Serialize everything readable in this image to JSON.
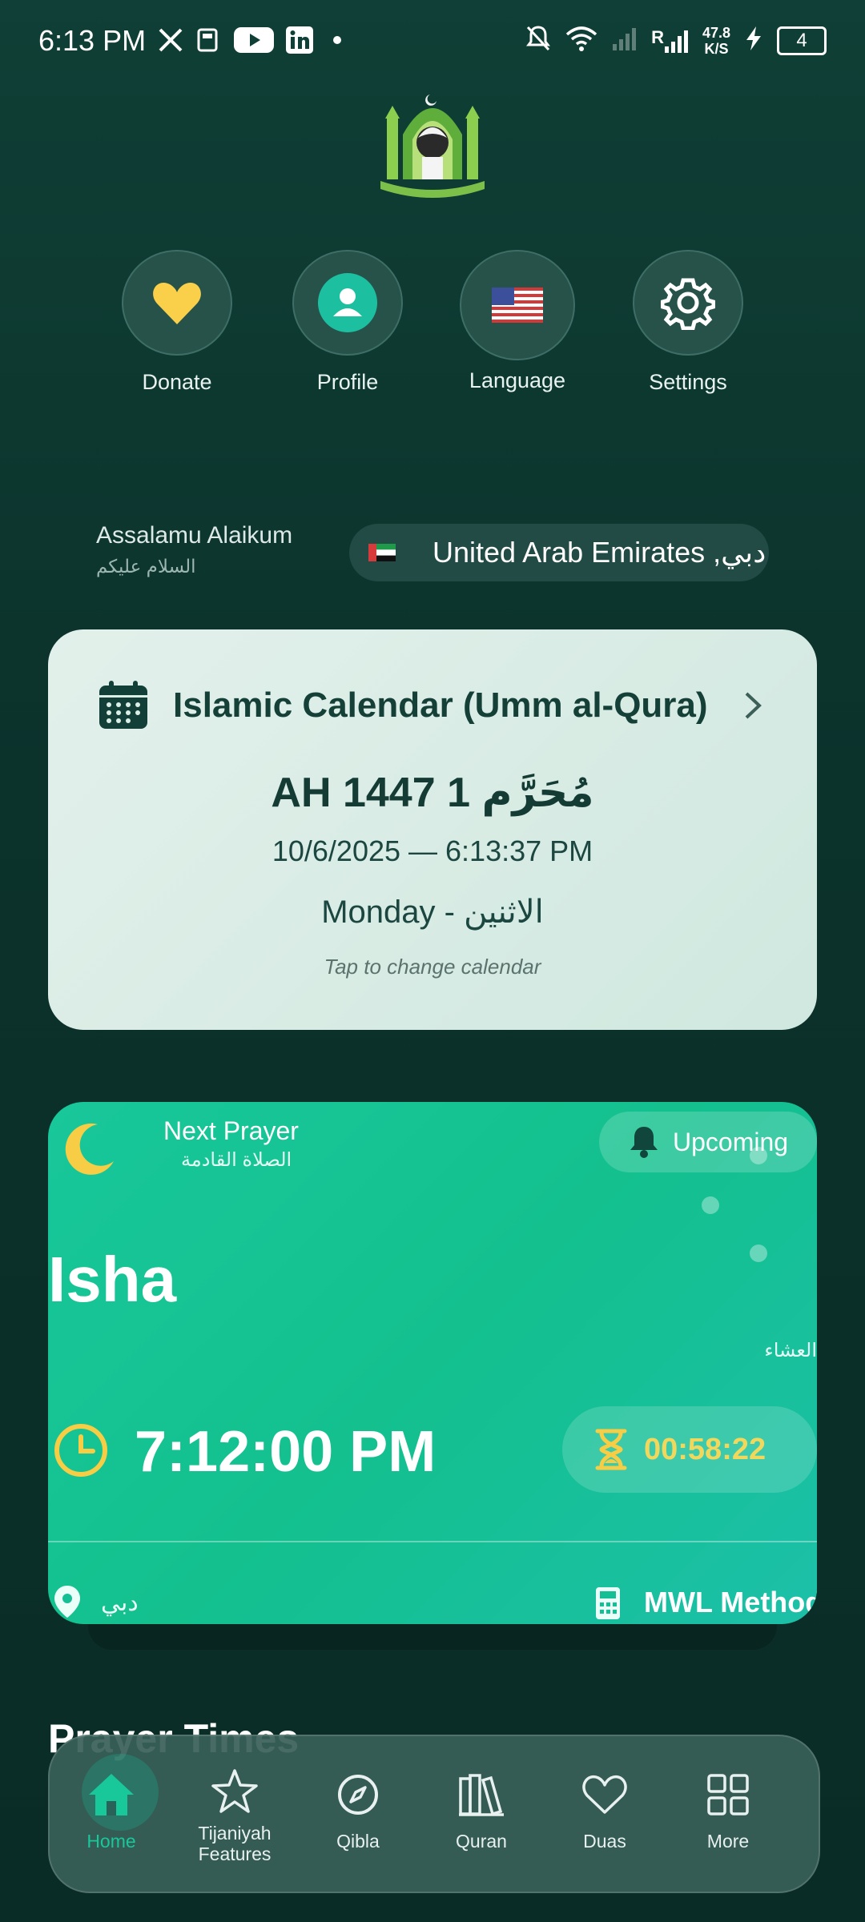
{
  "status_bar": {
    "time": "6:13 PM",
    "network_speed_top": "47.8",
    "network_speed_unit": "K/S",
    "battery": "4",
    "signal_label": "R"
  },
  "quick_actions": [
    {
      "label": "Donate",
      "icon": "heart-icon"
    },
    {
      "label": "Profile",
      "icon": "user-icon"
    },
    {
      "label": "Language",
      "icon": "us-flag-icon"
    },
    {
      "label": "Settings",
      "icon": "gear-icon"
    }
  ],
  "greeting": {
    "english": "Assalamu Alaikum",
    "arabic": "السلام عليكم"
  },
  "location": {
    "text": "United Arab Emirates ,دبي",
    "flag": "uae-flag-icon"
  },
  "calendar": {
    "title": "Islamic Calendar (Umm al-Qura)",
    "hijri_date": "AH 1447 مُحَرَّم 1",
    "gregorian": "10/6/2025 — 6:13:37 PM",
    "day": "Monday - الاثنين",
    "hint": "Tap to change calendar"
  },
  "next_prayer": {
    "label": "Next Prayer",
    "label_ar": "الصلاة القادمة",
    "status": "Upcoming",
    "name": "Isha",
    "name_ar": "العشاء",
    "time": "7:12:00 PM",
    "countdown": "00:58:22",
    "city": "دبي",
    "method": "MWL Method"
  },
  "sections": {
    "prayer_times_title": "Prayer Times"
  },
  "bottom_nav": [
    {
      "label": "Home",
      "active": true,
      "icon": "home-icon"
    },
    {
      "label": "Tijaniyah Features",
      "icon": "star-icon"
    },
    {
      "label": "Qibla",
      "icon": "compass-icon"
    },
    {
      "label": "Quran",
      "icon": "books-icon"
    },
    {
      "label": "Duas",
      "icon": "heart-outline-icon"
    },
    {
      "label": "More",
      "icon": "grid-icon"
    }
  ],
  "colors": {
    "background": "#0f3f36",
    "accent_green": "#15bf96",
    "gold": "#f2d75d",
    "calendar_card": "#dcefe7"
  }
}
